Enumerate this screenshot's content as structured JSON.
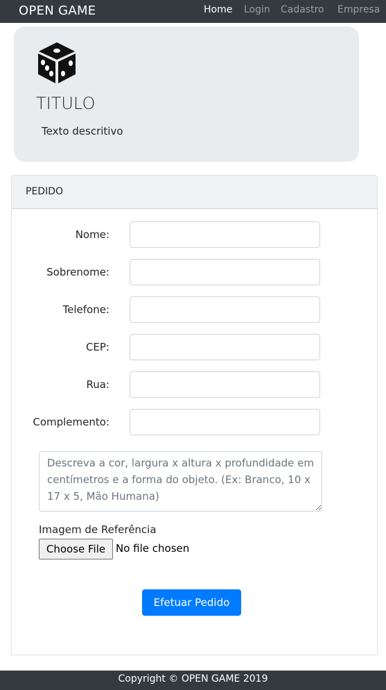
{
  "navbar": {
    "brand": "OPEN GAME",
    "items": [
      {
        "label": "Home",
        "active": true
      },
      {
        "label": "Login",
        "active": false
      },
      {
        "label": "Cadastro",
        "active": false
      },
      {
        "label": "Empresa",
        "active": false
      }
    ]
  },
  "jumbotron": {
    "icon": "dice-icon",
    "title": "TITULO",
    "text": "Texto descritivo"
  },
  "order_card": {
    "header": "PEDIDO",
    "fields": [
      {
        "label": "Nome:",
        "value": ""
      },
      {
        "label": "Sobrenome:",
        "value": ""
      },
      {
        "label": "Telefone:",
        "value": ""
      },
      {
        "label": "CEP:",
        "value": ""
      },
      {
        "label": "Rua:",
        "value": ""
      },
      {
        "label": "Complemento:",
        "value": ""
      }
    ],
    "description_placeholder": "Descreva a cor, largura x altura x profundidade em centímetros e a forma do objeto. (Ex: Branco, 10 x 17 x 5, Mão Humana)",
    "file_label": "Imagem de Referência",
    "file_button": "Choose File",
    "file_status": "No file chosen",
    "submit_label": "Efetuar Pedido"
  },
  "footer": {
    "text": "Copyright © OPEN GAME 2019"
  },
  "colors": {
    "navbar": "#343a40",
    "jumbotron": "#e9ecef",
    "primary": "#007bff",
    "nav_muted": "rgba(255,255,255,0.5)"
  }
}
